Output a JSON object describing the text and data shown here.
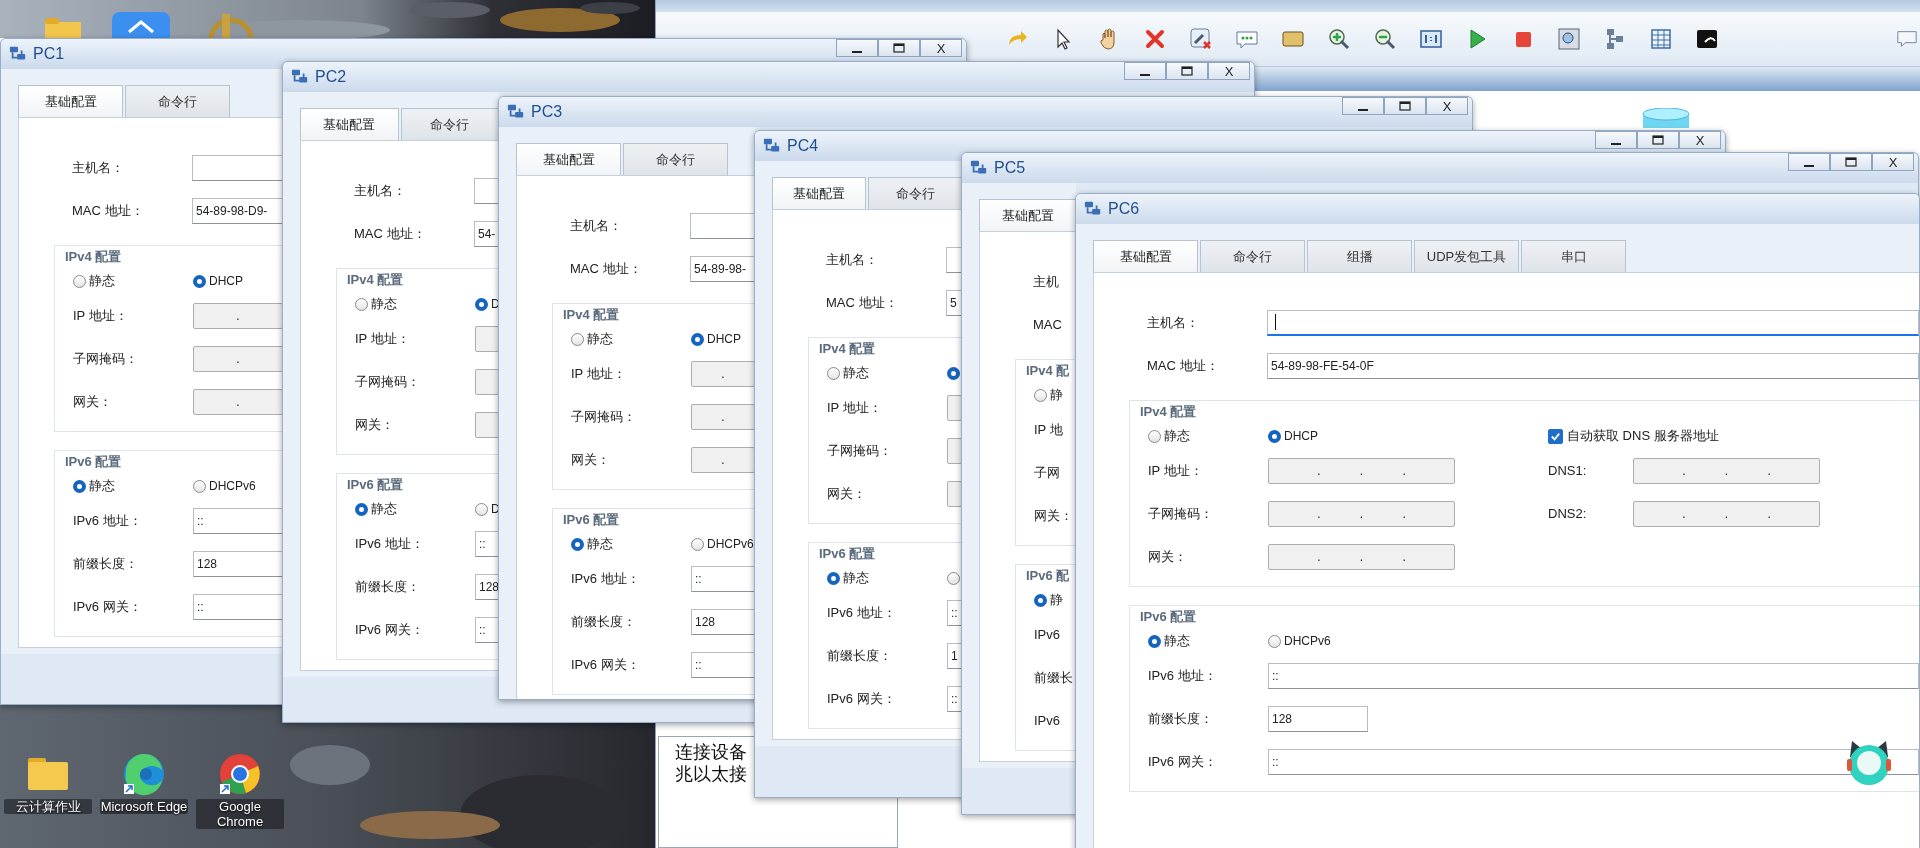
{
  "desktop": {
    "icons": [
      {
        "label": "云计算作业",
        "kind": "folder"
      },
      {
        "label": "Microsoft Edge",
        "kind": "edge"
      },
      {
        "label": "Google Chrome",
        "kind": "chrome"
      }
    ]
  },
  "description_panel": {
    "lines": [
      "连接设备",
      "兆以太接"
    ]
  },
  "windows": [
    {
      "title": "PC1",
      "close_label": "X",
      "tabs": [
        {
          "label": "基础配置",
          "selected": true
        },
        {
          "label": "命令行",
          "selected": false
        }
      ],
      "top_rows": [
        {
          "label": "主机名：",
          "kind": "text",
          "focused": false
        },
        {
          "label": "MAC 地址：",
          "kind": "text",
          "value": "54-89-98-D9-",
          "focused": false
        }
      ],
      "ipv4": {
        "title": "IPv4 配置",
        "radios": [
          {
            "label": "静态",
            "selected": false
          },
          {
            "label": "DHCP",
            "selected": true
          }
        ],
        "rows": [
          {
            "label": "IP 地址：",
            "kind": "ip",
            "value": "."
          },
          {
            "label": "子网掩码：",
            "kind": "ip",
            "value": "."
          },
          {
            "label": "网关：",
            "kind": "ip",
            "value": "."
          }
        ]
      },
      "ipv6": {
        "title": "IPv6 配置",
        "radios": [
          {
            "label": "静态",
            "selected": true
          },
          {
            "label": "DHCPv6",
            "selected": false
          }
        ],
        "rows": [
          {
            "label": "IPv6 地址：",
            "kind": "text",
            "value": "::"
          },
          {
            "label": "前缀长度：",
            "kind": "short",
            "value": "128"
          },
          {
            "label": "IPv6 网关：",
            "kind": "text",
            "value": "::"
          }
        ]
      }
    },
    {
      "title": "PC2",
      "close_label": "X",
      "tabs": [
        {
          "label": "基础配置",
          "selected": true
        },
        {
          "label": "命令行",
          "selected": false
        }
      ],
      "top_rows": [
        {
          "label": "主机名：",
          "kind": "text",
          "focused": false
        },
        {
          "label": "MAC 地址：",
          "kind": "text",
          "value": "54-",
          "focused": false
        }
      ],
      "ipv4": {
        "title": "IPv4 配置",
        "radios": [
          {
            "label": "静态",
            "selected": false
          },
          {
            "label": "D",
            "selected": true
          }
        ],
        "rows": [
          {
            "label": "IP 地址：",
            "kind": "ip"
          },
          {
            "label": "子网掩码：",
            "kind": "ip"
          },
          {
            "label": "网关：",
            "kind": "ip"
          }
        ]
      },
      "ipv6": {
        "title": "IPv6 配置",
        "radios": [
          {
            "label": "静态",
            "selected": true
          },
          {
            "label": "D",
            "selected": false
          }
        ],
        "rows": [
          {
            "label": "IPv6 地址：",
            "kind": "text",
            "value": "::"
          },
          {
            "label": "前缀长度：",
            "kind": "short",
            "value": "128"
          },
          {
            "label": "IPv6 网关：",
            "kind": "text",
            "value": "::"
          }
        ]
      }
    },
    {
      "title": "PC3",
      "close_label": "X",
      "tabs": [
        {
          "label": "基础配置",
          "selected": true
        },
        {
          "label": "命令行",
          "selected": false
        }
      ],
      "top_rows": [
        {
          "label": "主机名：",
          "kind": "text",
          "focused": false
        },
        {
          "label": "MAC 地址：",
          "kind": "text",
          "value": "54-89-98-",
          "focused": false
        }
      ],
      "ipv4": {
        "title": "IPv4 配置",
        "radios": [
          {
            "label": "静态",
            "selected": false
          },
          {
            "label": "DHCP",
            "selected": true
          }
        ],
        "rows": [
          {
            "label": "IP 地址：",
            "kind": "ip",
            "value": "."
          },
          {
            "label": "子网掩码：",
            "kind": "ip",
            "value": "."
          },
          {
            "label": "网关：",
            "kind": "ip",
            "value": "."
          }
        ]
      },
      "ipv6": {
        "title": "IPv6 配置",
        "radios": [
          {
            "label": "静态",
            "selected": true
          },
          {
            "label": "DHCPv6",
            "selected": false
          }
        ],
        "rows": [
          {
            "label": "IPv6 地址：",
            "kind": "text",
            "value": "::"
          },
          {
            "label": "前缀长度：",
            "kind": "short",
            "value": "128"
          },
          {
            "label": "IPv6 网关：",
            "kind": "text",
            "value": "::"
          }
        ]
      }
    },
    {
      "title": "PC4",
      "close_label": "X",
      "tabs": [
        {
          "label": "基础配置",
          "selected": true
        },
        {
          "label": "命令行",
          "selected": false
        }
      ],
      "top_rows": [
        {
          "label": "主机名：",
          "kind": "text",
          "focused": false
        },
        {
          "label": "MAC 地址：",
          "kind": "text",
          "value": "5",
          "focused": false
        }
      ],
      "ipv4": {
        "title": "IPv4 配置",
        "radios": [
          {
            "label": "静态",
            "selected": false
          },
          {
            "selected": true
          }
        ],
        "rows": [
          {
            "label": "IP 地址：",
            "kind": "ip"
          },
          {
            "label": "子网掩码：",
            "kind": "ip"
          },
          {
            "label": "网关：",
            "kind": "ip"
          }
        ]
      },
      "ipv6": {
        "title": "IPv6 配置",
        "radios": [
          {
            "label": "静态",
            "selected": true
          },
          {
            "selected": false
          }
        ],
        "rows": [
          {
            "label": "IPv6 地址：",
            "kind": "text",
            "value": "::"
          },
          {
            "label": "前缀长度：",
            "kind": "short",
            "value": "1"
          },
          {
            "label": "IPv6 网关：",
            "kind": "text",
            "value": "::"
          }
        ]
      }
    },
    {
      "title": "PC5",
      "close_label": "X",
      "tabs": [
        {
          "label": "基础配置",
          "selected": true
        }
      ],
      "top_rows": [
        {
          "label": "主机"
        },
        {
          "label": "MAC"
        }
      ],
      "ipv4": {
        "title": "IPv4 配",
        "radios": [
          {
            "label": "静",
            "selected": false
          }
        ],
        "rows": [
          {
            "label": "IP 地"
          },
          {
            "label": "子网"
          },
          {
            "label": "网关："
          }
        ]
      },
      "ipv6": {
        "title": "IPv6 配",
        "radios": [
          {
            "label": "静",
            "selected": true
          }
        ],
        "rows": [
          {
            "label": "IPv6"
          },
          {
            "label": "前缀长"
          },
          {
            "label": "IPv6"
          }
        ]
      }
    },
    {
      "title": "PC6",
      "tabs": [
        {
          "label": "基础配置",
          "selected": true
        },
        {
          "label": "命令行",
          "selected": false
        },
        {
          "label": "组播",
          "selected": false
        },
        {
          "label": "UDP发包工具",
          "selected": false
        },
        {
          "label": "串口",
          "selected": false
        }
      ],
      "top_rows": [
        {
          "label": "主机名：",
          "kind": "text",
          "focused": true
        },
        {
          "label": "MAC 地址：",
          "kind": "text",
          "value": "54-89-98-FE-54-0F",
          "focused": false
        }
      ],
      "ipv4": {
        "title": "IPv4 配置",
        "radios": [
          {
            "label": "静态",
            "selected": false
          },
          {
            "label": "DHCP",
            "selected": true
          }
        ],
        "rows": [
          {
            "label": "IP 地址：",
            "kind": "ip",
            "value": ". . ."
          },
          {
            "label": "子网掩码：",
            "kind": "ip",
            "value": ". . ."
          },
          {
            "label": "网关：",
            "kind": "ip",
            "value": ". . ."
          }
        ],
        "dns_option": {
          "label": "自动获取 DNS 服务器地址",
          "checked": true
        },
        "dns_rows": [
          {
            "label": "DNS1:",
            "kind": "ip",
            "value": ". . ."
          },
          {
            "label": "DNS2:",
            "kind": "ip",
            "value": ". . ."
          }
        ]
      },
      "ipv6": {
        "title": "IPv6 配置",
        "radios": [
          {
            "label": "静态",
            "selected": true
          },
          {
            "label": "DHCPv6",
            "selected": false
          }
        ],
        "rows": [
          {
            "label": "IPv6 地址：",
            "kind": "text",
            "value": "::"
          },
          {
            "label": "前缀长度：",
            "kind": "short",
            "value": "128"
          },
          {
            "label": "IPv6 网关：",
            "kind": "text",
            "value": "::"
          }
        ]
      }
    }
  ]
}
